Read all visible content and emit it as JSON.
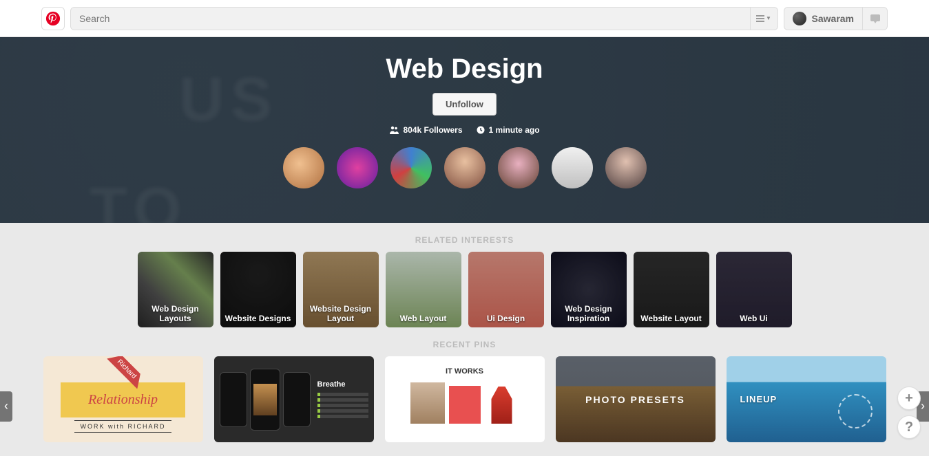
{
  "header": {
    "search_placeholder": "Search",
    "username": "Sawaram"
  },
  "hero": {
    "title": "Web Design",
    "unfollow_label": "Unfollow",
    "followers": "804k Followers",
    "last_activity": "1 minute ago",
    "contributor_count": 7
  },
  "sections": {
    "related_interests_label": "RELATED INTERESTS",
    "recent_pins_label": "RECENT PINS"
  },
  "related_interests": [
    {
      "label": "Web Design Layouts"
    },
    {
      "label": "Website Designs"
    },
    {
      "label": "Website Design Layout"
    },
    {
      "label": "Web Layout"
    },
    {
      "label": "Ui Design"
    },
    {
      "label": "Web Design Inspiration"
    },
    {
      "label": "Website Layout"
    },
    {
      "label": "Web Ui"
    }
  ],
  "recent_pins": [
    {
      "name": "pin-richard-relationship"
    },
    {
      "name": "pin-breathe-app"
    },
    {
      "name": "pin-it-works"
    },
    {
      "name": "pin-photo-presets"
    },
    {
      "name": "pin-ice-lineup"
    }
  ],
  "pin_text": {
    "p0_top": "Richard",
    "p0_mid": "Relationship",
    "p0_bot": "WORK with RICHARD",
    "p1": "Breathe",
    "p2": "IT WORKS",
    "p3": "PHOTO PRESETS",
    "p4": "LINEUP"
  },
  "avatars_bg": [
    "radial-gradient(circle at 40% 40%, #f0c090, #b07040)",
    "radial-gradient(circle at 50% 50%, #e040a0, #6020a0)",
    "conic-gradient(#4080d0, #40c060, #d04040, #4080d0)",
    "radial-gradient(circle at 50% 35%, #e8c0a0, #805040)",
    "radial-gradient(circle at 50% 40%, #e8b0c0, #604030)",
    "linear-gradient(#f0f0f0, #c0c0c0)",
    "radial-gradient(circle at 50% 35%, #e0c0b0, #504040)"
  ],
  "interest_bg": [
    "linear-gradient(45deg,#2a2a2a,#555,#8a6,#333)",
    "radial-gradient(circle at 50% 30%,#222,#111),linear-gradient(#e09060,#222)",
    "linear-gradient(#c0a070,#8a6a40)",
    "linear-gradient(#e4f4e4,#90b070)",
    "linear-gradient(#f4a090,#e47060)",
    "radial-gradient(circle,#334,#112)",
    "linear-gradient(#333,#222)",
    "linear-gradient(#3a3548,#2a2538)"
  ]
}
